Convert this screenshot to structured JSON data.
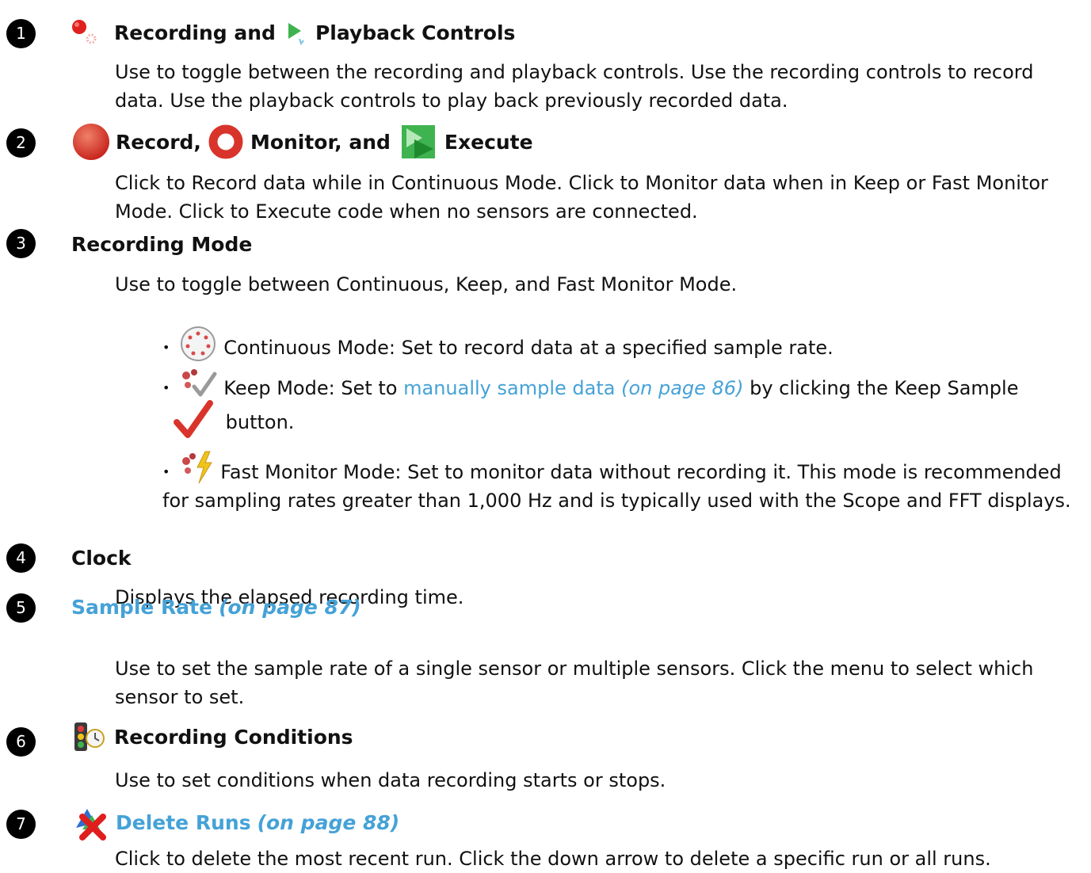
{
  "items": [
    {
      "number": "1",
      "title_a": "Recording and",
      "title_b": "Playback Controls",
      "description": "Use to toggle between the recording and playback controls. Use the recording controls to record data. Use the playback controls to play back previously recorded data."
    },
    {
      "number": "2",
      "title_a": "Record,",
      "title_b": "Monitor, and",
      "title_c": "Execute",
      "description": "Click to Record data while in Continuous Mode. Click to Monitor data when in Keep or Fast Monitor Mode. Click to Execute code when no sensors are connected."
    },
    {
      "number": "3",
      "title": "Recording Mode",
      "description": "Use to toggle between Continuous, Keep, and Fast Monitor Mode.",
      "bullets": [
        {
          "text": "Continuous Mode: Set to record data at a specified sample rate."
        },
        {
          "text_a": "Keep Mode: Set to",
          "link": "manually sample data",
          "page_ref": "(on page 86)",
          "text_b": "by clicking the Keep Sample",
          "text_c": "button."
        },
        {
          "text": "Fast Monitor Mode: Set to monitor data without recording it. This mode is recommended for sampling rates greater than 1,000 Hz and is typically used with the Scope and FFT displays."
        }
      ]
    },
    {
      "number": "4",
      "title": "Clock",
      "description": "Displays the elapsed recording time."
    },
    {
      "number": "5",
      "title": "Sample Rate",
      "page_ref": "(on page 87)",
      "description": "Use to set the sample rate of a single sensor or multiple sensors. Click the menu to select which sensor to set."
    },
    {
      "number": "6",
      "title": "Recording Conditions",
      "description": "Use to set conditions when data recording starts or stops."
    },
    {
      "number": "7",
      "title": "Delete Runs",
      "page_ref": "(on page 88)",
      "description": "Click to delete the most recent run. Click the down arrow to delete a specific run or all runs."
    }
  ],
  "colors": {
    "link": "#45a2d7",
    "record_red": "#d9342b",
    "execute_green": "#3fb34f",
    "badge": "#000000"
  }
}
